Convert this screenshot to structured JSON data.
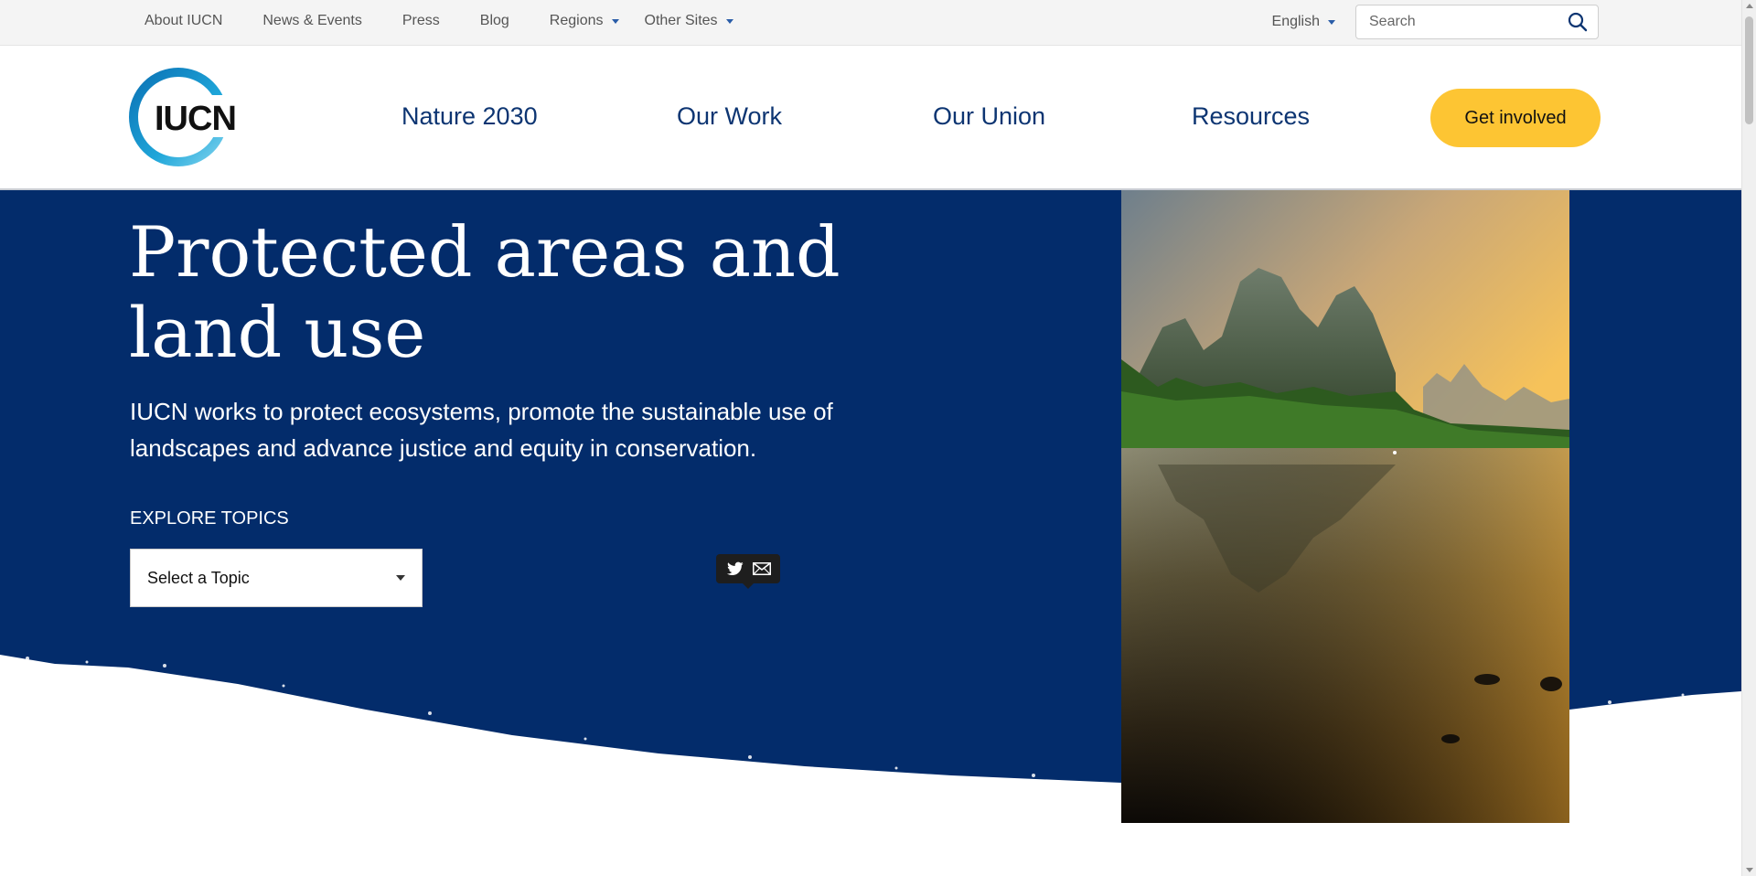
{
  "utility_bar": {
    "links": [
      {
        "label": "About IUCN",
        "dropdown": false
      },
      {
        "label": "News & Events",
        "dropdown": false
      },
      {
        "label": "Press",
        "dropdown": false
      },
      {
        "label": "Blog",
        "dropdown": false
      },
      {
        "label": "Regions",
        "dropdown": true
      },
      {
        "label": "Other Sites",
        "dropdown": true
      }
    ],
    "language": "English",
    "search_placeholder": "Search"
  },
  "header": {
    "logo_text": "IUCN",
    "nav": [
      {
        "label": "Nature 2030"
      },
      {
        "label": "Our Work"
      },
      {
        "label": "Our Union"
      },
      {
        "label": "Resources"
      }
    ],
    "cta_label": "Get involved"
  },
  "hero": {
    "title": "Protected areas and land use",
    "description": "IUCN works to protect ecosystems, promote the sustainable use of landscapes and advance justice and equity in conservation.",
    "explore_label": "EXPLORE TOPICS",
    "topic_select": "Select a Topic"
  },
  "share": {
    "icons": [
      "twitter-icon",
      "email-icon"
    ]
  },
  "colors": {
    "navy": "#032c6b",
    "nav_text": "#0d3572",
    "cta": "#fdc533",
    "logo_accent": "#1fa6d9"
  }
}
